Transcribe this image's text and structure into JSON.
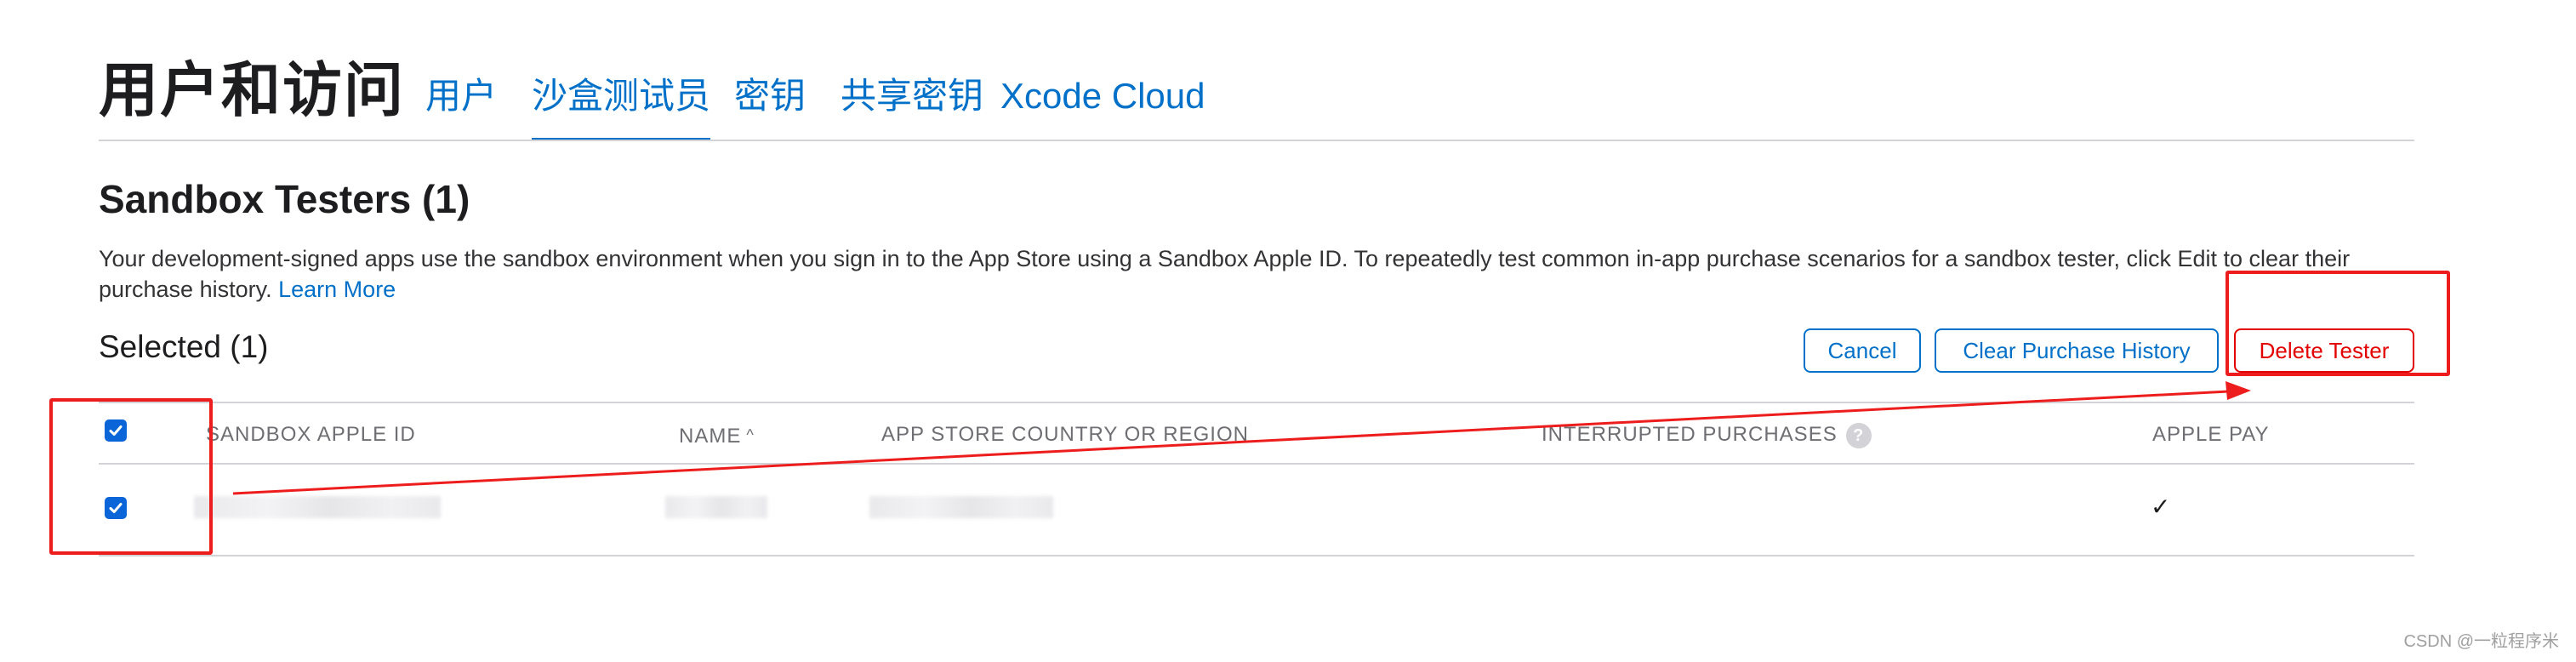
{
  "header": {
    "title": "用户和访问",
    "tabs": [
      {
        "label": "用户",
        "active": false
      },
      {
        "label": "沙盒测试员",
        "active": true
      },
      {
        "label": "密钥",
        "active": false
      },
      {
        "label": "共享密钥",
        "active": false
      },
      {
        "label": "Xcode Cloud",
        "active": false
      }
    ]
  },
  "section": {
    "title": "Sandbox Testers (1)",
    "description": "Your development-signed apps use the sandbox environment when you sign in to the App Store using a Sandbox Apple ID. To repeatedly test common in-app purchase scenarios for a sandbox tester, click Edit to clear their purchase history.",
    "learn_more": "Learn More",
    "selected_label": "Selected (1)"
  },
  "actions": {
    "cancel": "Cancel",
    "clear_history": "Clear Purchase History",
    "delete_tester": "Delete Tester"
  },
  "table": {
    "columns": {
      "sandbox_apple_id": "SANDBOX APPLE ID",
      "name": "NAME",
      "sort_indicator": "^",
      "country": "APP STORE COUNTRY OR REGION",
      "interrupted": "INTERRUPTED PURCHASES",
      "interrupted_help": "?",
      "apple_pay": "APPLE PAY"
    },
    "rows": [
      {
        "selected": true,
        "apple_pay": "✓"
      }
    ],
    "header_checkbox_checked": true
  },
  "colors": {
    "accent": "#0070c9",
    "danger": "#e30000",
    "annotation": "#ee1d1d",
    "checkbox": "#0a66d8"
  },
  "watermark": "CSDN @一粒程序米"
}
